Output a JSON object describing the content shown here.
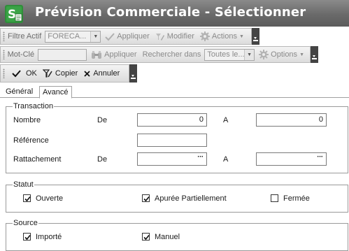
{
  "window": {
    "title": "Prévision Commerciale - Sélectionner"
  },
  "toolbar1": {
    "filter_label": "Filtre Actif",
    "filter_value": "FORECA...",
    "apply_label": "Appliquer",
    "modify_label": "Modifier",
    "actions_label": "Actions"
  },
  "toolbar2": {
    "keyword_label": "Mot-Clé",
    "keyword_value": "",
    "apply_label": "Appliquer",
    "search_in_label": "Rechercher dans",
    "search_in_value": "Toutes le...",
    "options_label": "Options"
  },
  "toolbar3": {
    "ok_label": "OK",
    "copy_label": "Copier",
    "cancel_label": "Annuler"
  },
  "tabs": [
    {
      "label": "Général",
      "selected": false
    },
    {
      "label": "Avancé",
      "selected": true
    }
  ],
  "transaction": {
    "legend": "Transaction",
    "nombre_label": "Nombre",
    "de_label": "De",
    "a_label": "A",
    "nombre_de_value": "0",
    "nombre_a_value": "0",
    "reference_label": "Référence",
    "reference_value": "",
    "rattachement_label": "Rattachement",
    "rattachement_de_value": "",
    "rattachement_a_value": ""
  },
  "statut": {
    "legend": "Statut",
    "ouverte_label": "Ouverte",
    "ouverte_checked": true,
    "apuree_label": "Apurée Partiellement",
    "apuree_checked": true,
    "fermee_label": "Fermée",
    "fermee_checked": false
  },
  "source": {
    "legend": "Source",
    "importe_label": "Importé",
    "importe_checked": true,
    "manuel_label": "Manuel",
    "manuel_checked": true
  }
}
